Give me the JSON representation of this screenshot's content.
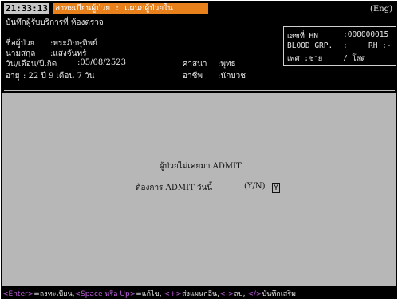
{
  "header": {
    "clock": "21:33:13",
    "screen_title": "ลงทะเบียนผู้ป่วย : แผนกผู้ป่วยใน",
    "language": "(Eng)",
    "subtitle": "บันทึกผู้รับบริการที่ ห้องตรวจ"
  },
  "info_box": {
    "hn_label": "เลขที่ HN",
    "hn_value": ":000000015",
    "blood_label": "BLOOD GRP.",
    "blood_value": ":",
    "rh_label": "RH :-",
    "sex_label": "เพศ :ชาย",
    "status_value": "/ โสด"
  },
  "patient": {
    "name_label": "ชื่อผู้ป่วย",
    "name_value": ":พระภิกษุทิพย์",
    "surname_label": "นามสกุล",
    "surname_value": ":แสงจันทร์",
    "dob_label": "วัน/เดือน/ปีเกิด",
    "dob_value": ":05/08/2523",
    "religion_label": "ศาสนา",
    "religion_value": ":พุทธ",
    "age_label": "อายุ",
    "age_value": ": 22 ปี 9 เดือน 7 วัน",
    "occupation_label": "อาชีพ",
    "occupation_value": ":นักบวช"
  },
  "dialog": {
    "message": "ผู้ป่วยไม่เคยมา ADMIT",
    "question": "ต้องการ ADMIT วันนี้",
    "options": "(Y/N)",
    "answer": "Y"
  },
  "footer": {
    "k1": "<Enter>",
    "d1": "=ลงทะเบียน,",
    "k2": "<Space หรือ Up>",
    "d2": "=แก้ไข, ",
    "k3": "<+>",
    "d3": "ส่งแผนกอื่น,",
    "k4": "<->",
    "d4": "ลบ, ",
    "k5": "</>",
    "d5": "บันทึกเสริม"
  }
}
